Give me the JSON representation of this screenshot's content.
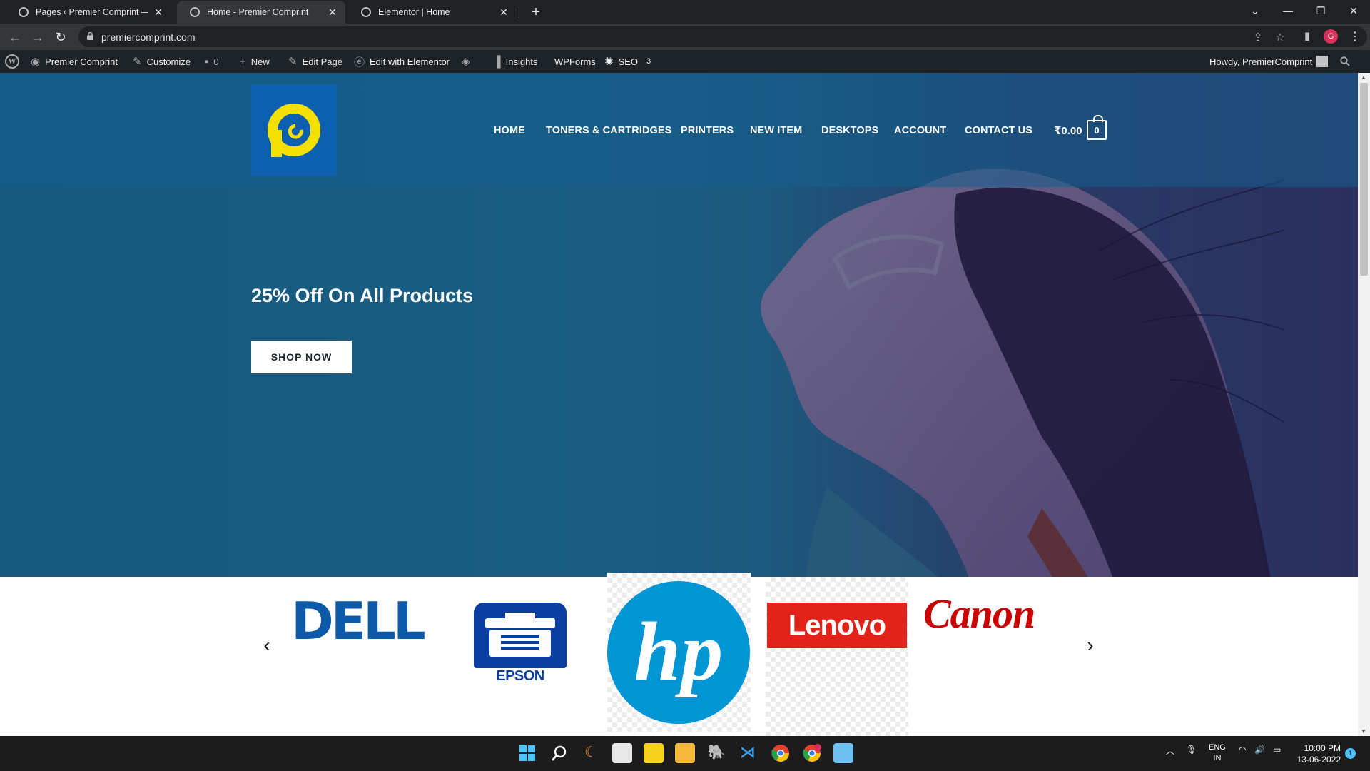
{
  "browser": {
    "tabs": [
      {
        "title": "Pages ‹ Premier Comprint — Wo"
      },
      {
        "title": "Home - Premier Comprint"
      },
      {
        "title": "Elementor | Home"
      }
    ],
    "url": "premiercomprint.com",
    "profile_initial": "G"
  },
  "admin_bar": {
    "site_name": "Premier Comprint",
    "customize": "Customize",
    "comments_count": "0",
    "new": "New",
    "edit_page": "Edit Page",
    "edit_elementor": "Edit with Elementor",
    "insights": "Insights",
    "wpforms": "WPForms",
    "seo": "SEO",
    "seo_count": "3",
    "howdy": "Howdy, PremierComprint"
  },
  "site": {
    "nav": [
      "HOME",
      "TONERS & CARTRIDGES",
      "PRINTERS",
      "NEW ITEM",
      "DESKTOPS",
      "ACCOUNT",
      "CONTACT US"
    ],
    "cart_total": "₹0.00",
    "cart_count": "0",
    "hero_title": "25% Off On All Products",
    "hero_button": "SHOP NOW",
    "brands": {
      "dell": "DELL",
      "epson": "EPSON",
      "hp": "hp",
      "lenovo": "Lenovo",
      "canon": "Canon"
    }
  },
  "taskbar": {
    "lang_top": "ENG",
    "lang_bottom": "IN",
    "time": "10:00 PM",
    "date": "13-06-2022",
    "notification_count": "1"
  },
  "colors": {
    "hero_blue": "#15597f",
    "logo_yellow": "#f5e000",
    "logo_blue": "#0d5fb0",
    "admin_bar": "#1d2327"
  }
}
